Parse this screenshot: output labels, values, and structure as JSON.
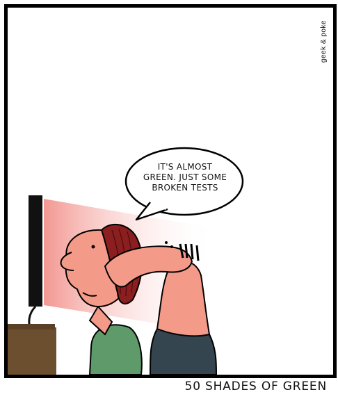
{
  "comic": {
    "credit": "geek & poke",
    "speech_bubble": "IT'S ALMOST\nGREEN. JUST SOME\nBROKEN TESTS",
    "caption": "50 SHADES OF GREEN"
  },
  "colors": {
    "screen_glow": "#f4a3a0",
    "skin": "#f39a88",
    "hair": "#8b1e1e",
    "shirt": "#5f9b6a",
    "pants": "#35454f",
    "desk": "#6b4f2f",
    "monitor": "#111111"
  }
}
